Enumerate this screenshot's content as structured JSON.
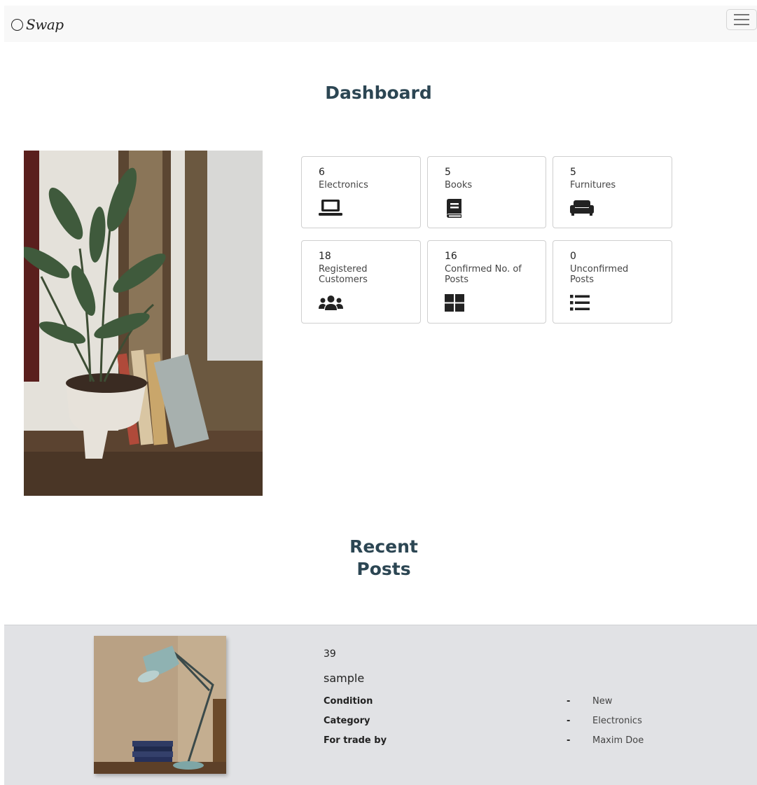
{
  "navbar": {
    "brand": "Swap",
    "menu_icon": "hamburger-menu-icon"
  },
  "dashboard": {
    "title": "Dashboard",
    "stats": [
      {
        "value": "6",
        "label": "Electronics",
        "icon": "laptop-icon"
      },
      {
        "value": "5",
        "label": "Books",
        "icon": "book-icon"
      },
      {
        "value": "5",
        "label": "Furnitures",
        "icon": "couch-icon"
      },
      {
        "value": "18",
        "label": "Registered Customers",
        "icon": "users-icon"
      },
      {
        "value": "16",
        "label": "Confirmed No. of Posts",
        "icon": "grid-icon"
      },
      {
        "value": "0",
        "label": "Unconfirmed Posts",
        "icon": "list-icon"
      }
    ]
  },
  "recent": {
    "title_line1": "Recent",
    "title_line2": "Posts",
    "post": {
      "id": "39",
      "name": "sample",
      "details": [
        {
          "key": "Condition",
          "sep": "-",
          "value": "New"
        },
        {
          "key": "Category",
          "sep": "-",
          "value": "Electronics"
        },
        {
          "key": "For trade by",
          "sep": "-",
          "value": "Maxim Doe"
        }
      ]
    }
  },
  "colors": {
    "heading": "#2c4653",
    "panel": "#e1e2e5"
  }
}
